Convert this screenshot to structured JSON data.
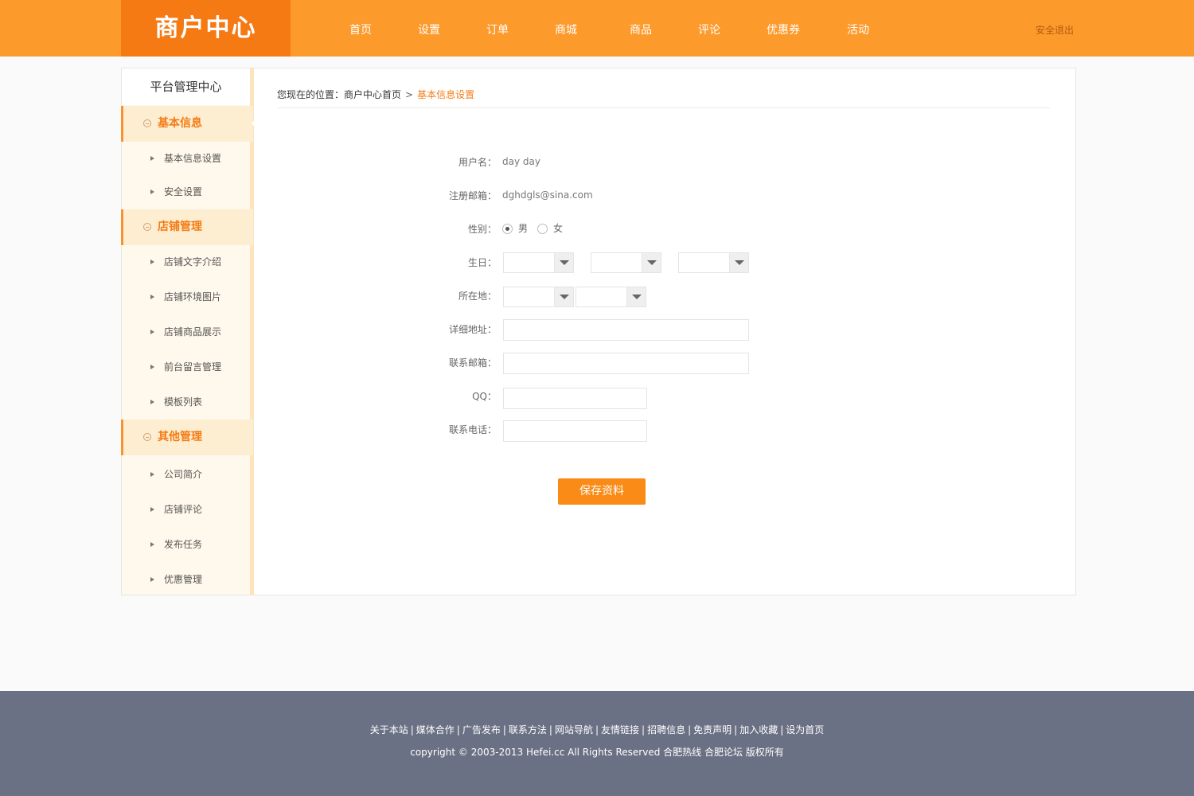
{
  "header": {
    "logo": "商户中心",
    "nav": [
      "首页",
      "设置",
      "订单",
      "商城",
      "商品",
      "评论",
      "优惠券",
      "活动"
    ],
    "logout": "安全退出"
  },
  "sidebar": {
    "title": "平台管理中心",
    "sections": [
      {
        "title": "基本信息",
        "items": [
          "基本信息设置",
          "安全设置"
        ]
      },
      {
        "title": "店铺管理",
        "items": [
          "店铺文字介绍",
          "店铺环境图片",
          "店铺商品展示",
          "前台留言管理",
          "模板列表"
        ]
      },
      {
        "title": "其他管理",
        "items": [
          "公司简介",
          "店铺评论",
          "发布任务",
          "优惠管理"
        ]
      }
    ]
  },
  "breadcrumb": {
    "prefix": "您现在的位置：",
    "home": "商户中心首页",
    "separator": ">",
    "current": "基本信息设置"
  },
  "form": {
    "username_label": "用户名：",
    "username_value": "day day",
    "email_label": "注册邮箱：",
    "email_value": "dghdgls@sina.com",
    "gender_label": "性别：",
    "gender_options": [
      "男",
      "女"
    ],
    "gender_selected": "男",
    "birthday_label": "生日：",
    "location_label": "所在地：",
    "address_label": "详细地址：",
    "contact_email_label": "联系邮箱：",
    "qq_label": "QQ：",
    "phone_label": "联系电话：",
    "save_label": "保存资料"
  },
  "footer": {
    "links": [
      "关于本站",
      "媒体合作",
      "广告发布",
      "联系方法",
      "网站导航",
      "友情链接",
      "招聘信息",
      "免责声明",
      "加入收藏",
      "设为首页"
    ],
    "separator": "|",
    "copyright": "copyright © 2003-2013 Hefei.cc All Rights Reserved 合肥热线 合肥论坛 版权所有"
  },
  "colors": {
    "header_bg": "#fd9a2c",
    "logo_bg": "#f57a14",
    "accent": "#f57b14",
    "footer_bg": "#6b7184"
  }
}
